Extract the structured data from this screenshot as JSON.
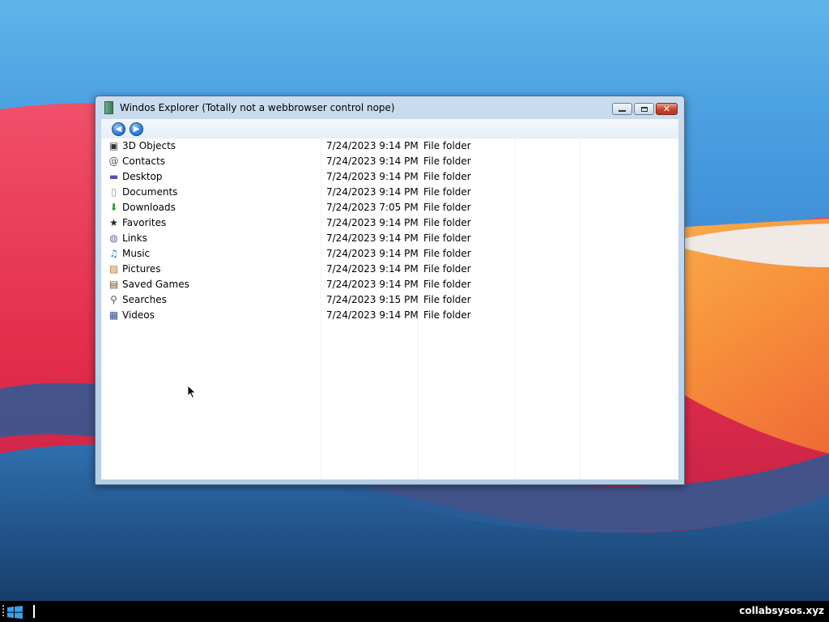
{
  "window": {
    "title": "Windos Explorer (Totally not a webbrowser control nope)",
    "controls": {
      "minimize": "minimize",
      "maximize": "maximize",
      "close": "✕"
    }
  },
  "toolbar": {
    "back_icon": "arrow-left-icon",
    "forward_icon": "arrow-right-icon"
  },
  "files": [
    {
      "name": "3D Objects",
      "date": "7/24/2023 9:14 PM",
      "type": "File folder",
      "icon": "3d-objects-icon"
    },
    {
      "name": "Contacts",
      "date": "7/24/2023 9:14 PM",
      "type": "File folder",
      "icon": "contacts-icon"
    },
    {
      "name": "Desktop",
      "date": "7/24/2023 9:14 PM",
      "type": "File folder",
      "icon": "desktop-icon"
    },
    {
      "name": "Documents",
      "date": "7/24/2023 9:14 PM",
      "type": "File folder",
      "icon": "documents-icon"
    },
    {
      "name": "Downloads",
      "date": "7/24/2023 7:05 PM",
      "type": "File folder",
      "icon": "downloads-icon"
    },
    {
      "name": "Favorites",
      "date": "7/24/2023 9:14 PM",
      "type": "File folder",
      "icon": "favorites-icon"
    },
    {
      "name": "Links",
      "date": "7/24/2023 9:14 PM",
      "type": "File folder",
      "icon": "links-icon"
    },
    {
      "name": "Music",
      "date": "7/24/2023 9:14 PM",
      "type": "File folder",
      "icon": "music-icon"
    },
    {
      "name": "Pictures",
      "date": "7/24/2023 9:14 PM",
      "type": "File folder",
      "icon": "pictures-icon"
    },
    {
      "name": "Saved Games",
      "date": "7/24/2023 9:14 PM",
      "type": "File folder",
      "icon": "saved-games-icon"
    },
    {
      "name": "Searches",
      "date": "7/24/2023 9:15 PM",
      "type": "File folder",
      "icon": "searches-icon"
    },
    {
      "name": "Videos",
      "date": "7/24/2023 9:14 PM",
      "type": "File folder",
      "icon": "videos-icon"
    }
  ],
  "taskbar": {
    "tray_text": "collabsysos.xyz"
  },
  "colors": {
    "accent": "#2f7fd0",
    "taskbar": "#000000",
    "close": "#c8432b"
  }
}
